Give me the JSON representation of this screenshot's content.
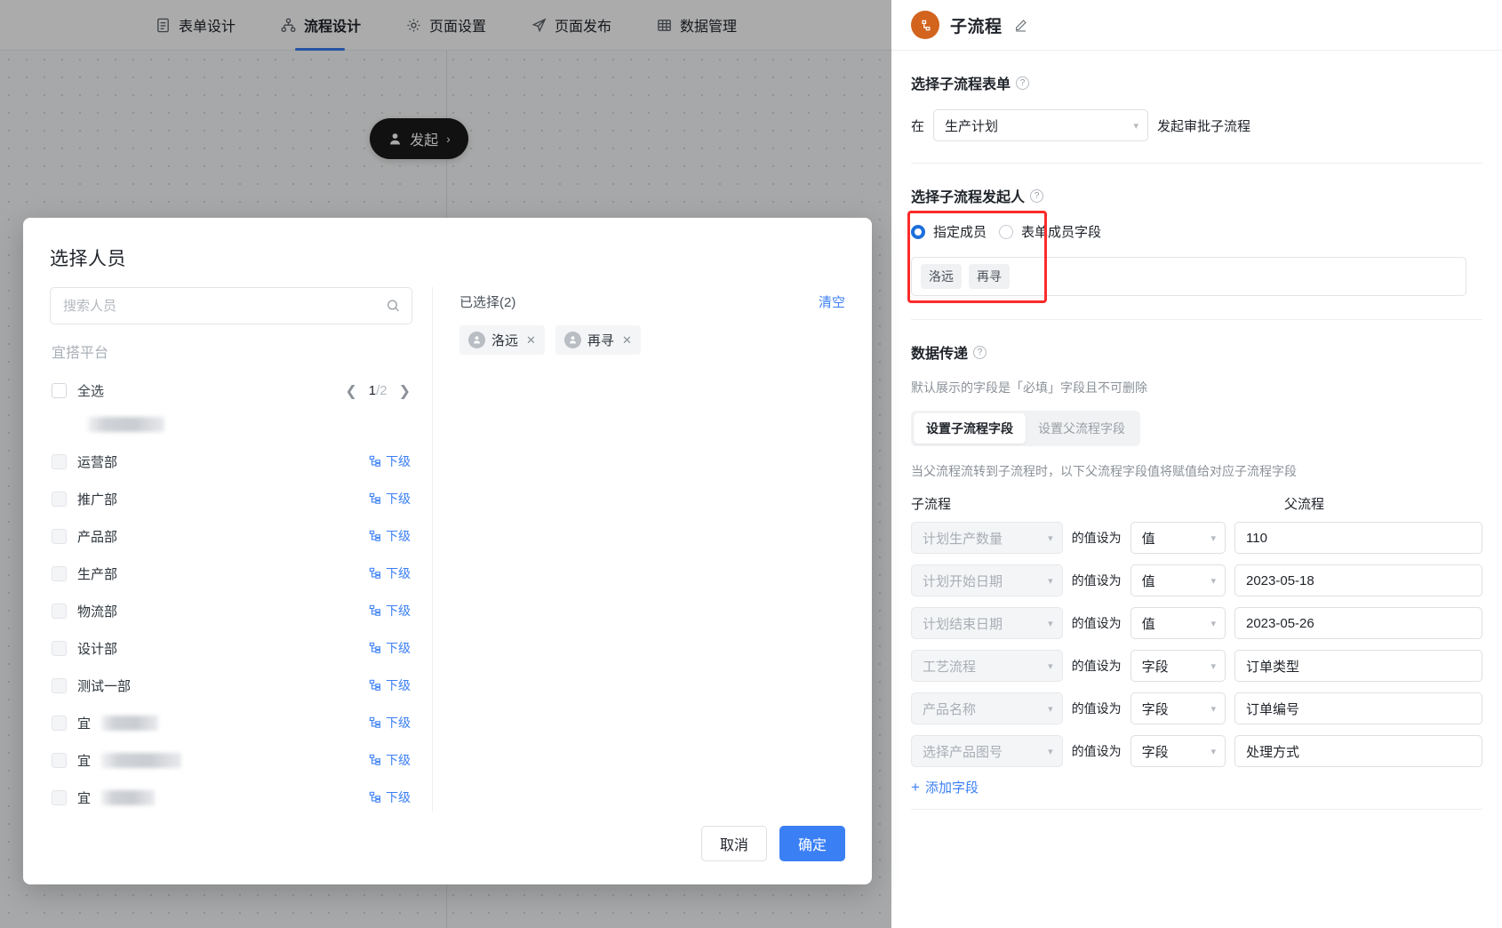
{
  "topnav": {
    "tabs": [
      {
        "label": "表单设计",
        "icon": "document-icon",
        "active": false
      },
      {
        "label": "流程设计",
        "icon": "flow-icon",
        "active": true
      },
      {
        "label": "页面设置",
        "icon": "gear-icon",
        "active": false
      },
      {
        "label": "页面发布",
        "icon": "send-icon",
        "active": false
      },
      {
        "label": "数据管理",
        "icon": "table-icon",
        "active": false
      }
    ]
  },
  "canvas": {
    "start_node": {
      "label": "发起",
      "icon": "person-icon",
      "chevron": "›"
    }
  },
  "panel": {
    "title": "子流程",
    "avatar_icon": "subflow-icon",
    "edit_icon": "pencil-icon",
    "accent_color": "#d2641e",
    "section_form": {
      "title": "选择子流程表单",
      "help_icon": "question-icon",
      "prefix": "在",
      "form_value": "生产计划",
      "suffix": "发起审批子流程"
    },
    "section_initiator": {
      "title": "选择子流程发起人",
      "help_icon": "question-icon",
      "options": [
        {
          "label": "指定成员",
          "selected": true
        },
        {
          "label": "表单成员字段",
          "selected": false
        }
      ],
      "members": [
        "洛远",
        "再寻"
      ],
      "highlight_color": "#fb2b2b"
    },
    "section_transfer": {
      "title": "数据传递",
      "help_icon": "question-icon",
      "hint": "默认展示的字段是「必填」字段且不可删除",
      "tabs": [
        {
          "label": "设置子流程字段",
          "active": true
        },
        {
          "label": "设置父流程字段",
          "active": false
        }
      ],
      "description": "当父流程流转到子流程时，以下父流程字段值将赋值给对应子流程字段",
      "col_child": "子流程",
      "col_parent": "父流程",
      "middle_label": "的值设为",
      "rows": [
        {
          "child": "计划生产数量",
          "mode": "值",
          "parent": "110"
        },
        {
          "child": "计划开始日期",
          "mode": "值",
          "parent": "2023-05-18"
        },
        {
          "child": "计划结束日期",
          "mode": "值",
          "parent": "2023-05-26"
        },
        {
          "child": "工艺流程",
          "mode": "字段",
          "parent": "订单类型"
        },
        {
          "child": "产品名称",
          "mode": "字段",
          "parent": "订单编号"
        },
        {
          "child": "选择产品图号",
          "mode": "字段",
          "parent": "处理方式"
        }
      ],
      "add_field": "添加字段",
      "add_icon": "plus-icon"
    }
  },
  "modal": {
    "title": "选择人员",
    "search": {
      "placeholder": "搜索人员",
      "value": "",
      "icon": "search-icon"
    },
    "breadcrumb": "宜搭平台",
    "select_all": "全选",
    "pagination": {
      "current": "1",
      "total": "2",
      "separator": "/",
      "prev_icon": "chevron-left-icon",
      "next_icon": "chevron-right-icon"
    },
    "sub_label": "下级",
    "sub_icon": "org-tree-icon",
    "items": [
      {
        "name": "",
        "redacted": true,
        "redacted_width": 86,
        "checkbox": false,
        "sub": false
      },
      {
        "name": "运营部",
        "redacted": false,
        "checkbox": true,
        "sub": true
      },
      {
        "name": "推广部",
        "redacted": false,
        "checkbox": true,
        "sub": true
      },
      {
        "name": "产品部",
        "redacted": false,
        "checkbox": true,
        "sub": true
      },
      {
        "name": "生产部",
        "redacted": false,
        "checkbox": true,
        "sub": true
      },
      {
        "name": "物流部",
        "redacted": false,
        "checkbox": true,
        "sub": true
      },
      {
        "name": "设计部",
        "redacted": false,
        "checkbox": true,
        "sub": true
      },
      {
        "name": "测试一部",
        "redacted": false,
        "checkbox": true,
        "sub": true
      },
      {
        "name": "宜",
        "redacted": true,
        "redacted_width": 64,
        "checkbox": true,
        "sub": true
      },
      {
        "name": "宜",
        "redacted": true,
        "redacted_width": 90,
        "checkbox": true,
        "sub": true
      },
      {
        "name": "宜",
        "redacted": true,
        "redacted_width": 60,
        "checkbox": true,
        "sub": true
      }
    ],
    "selected": {
      "label": "已选择(2)",
      "clear": "清空",
      "chips": [
        {
          "name": "洛远",
          "avatar_icon": "person-avatar-icon",
          "remove_icon": "close-icon"
        },
        {
          "name": "再寻",
          "avatar_icon": "person-avatar-icon",
          "remove_icon": "close-icon"
        }
      ]
    },
    "footer": {
      "cancel": "取消",
      "confirm": "确定",
      "confirm_color": "#3b7ff5"
    }
  }
}
